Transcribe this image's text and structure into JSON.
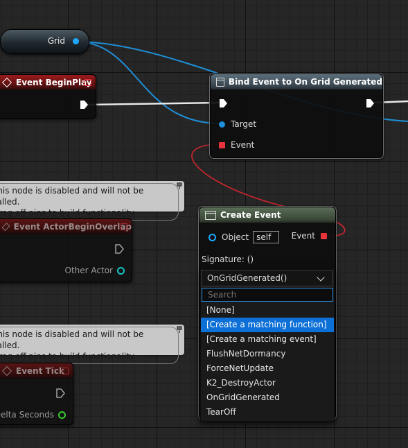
{
  "variable_node": {
    "label": "Grid"
  },
  "begin_play": {
    "title": "Event BeginPlay"
  },
  "bind_event": {
    "title": "Bind Event to On Grid Generated",
    "pin_target": "Target",
    "pin_event": "Event"
  },
  "comment1": {
    "line1": "This node is disabled and will not be called.",
    "line2": "Drag off pins to build functionality."
  },
  "comment2": {
    "line1": "This node is disabled and will not be called.",
    "line2": "Drag off pins to build functionality."
  },
  "overlap": {
    "title": "Event ActorBeginOverlap",
    "pin_other": "Other Actor"
  },
  "tick": {
    "title": "Event Tick",
    "pin_delta": "Delta Seconds"
  },
  "create_event": {
    "title": "Create Event",
    "pin_object": "Object",
    "object_value": "self",
    "pin_event": "Event",
    "signature": "Signature: ()",
    "selected": "OnGridGenerated()",
    "search_placeholder": "Search",
    "options": [
      "[None]",
      "[Create a matching function]",
      "[Create a matching event]",
      "FlushNetDormancy",
      "ForceNetUpdate",
      "K2_DestroyActor",
      "OnGridGenerated",
      "TearOff"
    ],
    "highlighted_index": 1
  },
  "colors": {
    "object_pin": "#1ea7ff",
    "delegate_pin": "#e8323c",
    "exec_wire": "#ffffff",
    "highlight": "#0d70d6"
  }
}
